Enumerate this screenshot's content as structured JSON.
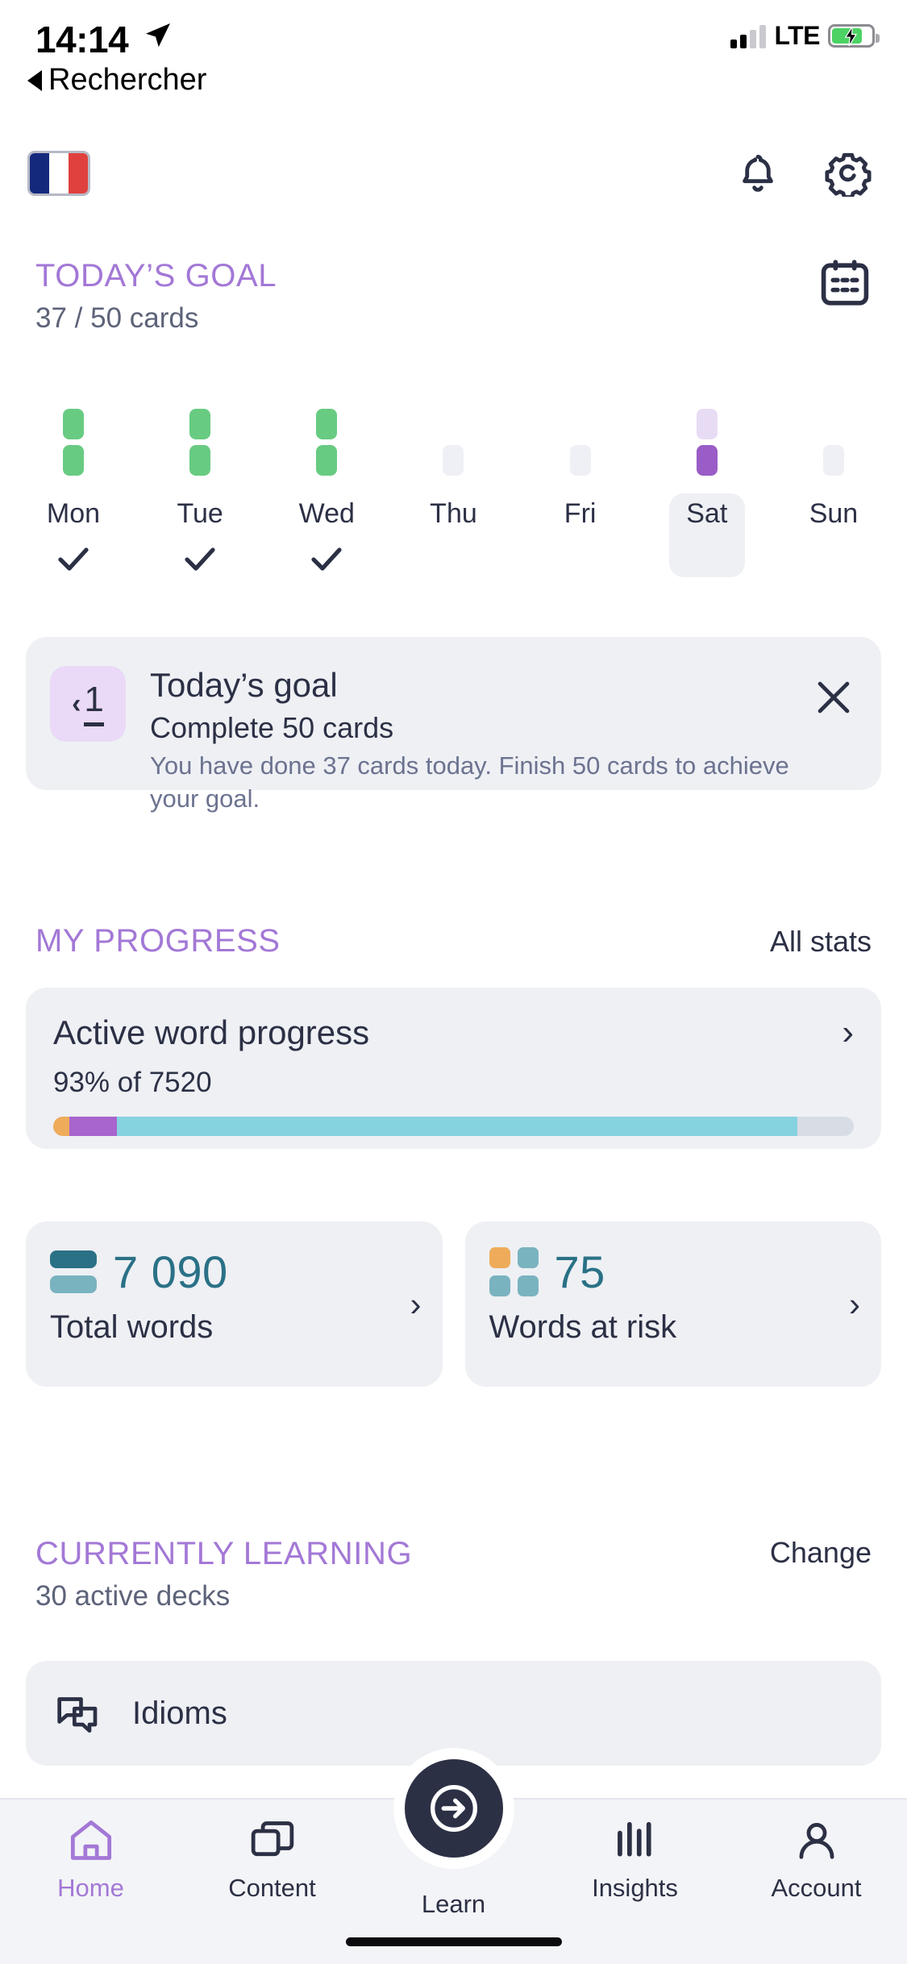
{
  "status_bar": {
    "time": "14:14",
    "location_icon": "location-arrow-icon",
    "carrier": "LTE",
    "signal_bars_filled": 2,
    "signal_bars_total": 4,
    "battery_charging": true,
    "battery_color": "#4cd364"
  },
  "back_link": {
    "label": "Rechercher"
  },
  "header": {
    "flag": "france-flag-icon",
    "notifications_icon": "bell-icon",
    "settings_icon": "gear-icon",
    "icon_color": "#2c3045"
  },
  "todays_goal": {
    "section_title": "TODAY’S GOAL",
    "progress_text": "37 / 50 cards",
    "calendar_icon": "calendar-icon",
    "accent_color": "#a378d6",
    "days": [
      {
        "name": "Mon",
        "top_bar": "green",
        "bottom_bar": "green",
        "checked": true,
        "today": false
      },
      {
        "name": "Tue",
        "top_bar": "green",
        "bottom_bar": "green",
        "checked": true,
        "today": false
      },
      {
        "name": "Wed",
        "top_bar": "green",
        "bottom_bar": "green",
        "checked": true,
        "today": false
      },
      {
        "name": "Thu",
        "top_bar": "none",
        "bottom_bar": "empty",
        "checked": false,
        "today": false
      },
      {
        "name": "Fri",
        "top_bar": "none",
        "bottom_bar": "empty",
        "checked": false,
        "today": false
      },
      {
        "name": "Sat",
        "top_bar": "purple-lite",
        "bottom_bar": "purple",
        "checked": false,
        "today": true
      },
      {
        "name": "Sun",
        "top_bar": "none",
        "bottom_bar": "empty",
        "checked": false,
        "today": false
      }
    ]
  },
  "goal_card": {
    "badge_chevron": "‹",
    "badge_number": "1",
    "title": "Today’s goal",
    "subtitle": "Complete 50 cards",
    "description": "You have done 37 cards today. Finish 50 cards to achieve your goal.",
    "close_icon": "close-icon",
    "badge_bg": "#ead9f7"
  },
  "my_progress": {
    "section_title": "MY PROGRESS",
    "action_label": "All stats",
    "active_word_progress": {
      "title": "Active word progress",
      "chevron": "›",
      "value_text": "93% of 7520",
      "percent": 93,
      "total": 7520,
      "segments": [
        {
          "name": "orange",
          "color": "#eeac5b",
          "width_pct": 2
        },
        {
          "name": "purple",
          "color": "#a765cd",
          "width_pct": 6
        },
        {
          "name": "teal",
          "color": "#86d3e0",
          "width_pct": 85
        }
      ],
      "track_color": "#d8dce4"
    },
    "stats": [
      {
        "icon": "stacked-bars-icon",
        "value": "7 090",
        "label": "Total words",
        "chevron": "›"
      },
      {
        "icon": "four-squares-icon",
        "value": "75",
        "label": "Words at risk",
        "chevron": "›"
      }
    ]
  },
  "currently_learning": {
    "section_title": "CURRENTLY LEARNING",
    "subtitle": "30 active decks",
    "action_label": "Change",
    "decks": [
      {
        "icon": "speech-bubbles-icon",
        "name": "Idioms"
      }
    ]
  },
  "tab_bar": {
    "items": [
      {
        "label": "Home",
        "icon": "home-icon",
        "active": true
      },
      {
        "label": "Content",
        "icon": "content-cards-icon",
        "active": false
      },
      {
        "label": "Learn",
        "icon": "arrow-in-circle-icon",
        "active": false
      },
      {
        "label": "Insights",
        "icon": "bar-chart-icon",
        "active": false
      },
      {
        "label": "Account",
        "icon": "person-icon",
        "active": false
      }
    ],
    "active_color": "#a378d6",
    "fab_color": "#2c3045"
  }
}
